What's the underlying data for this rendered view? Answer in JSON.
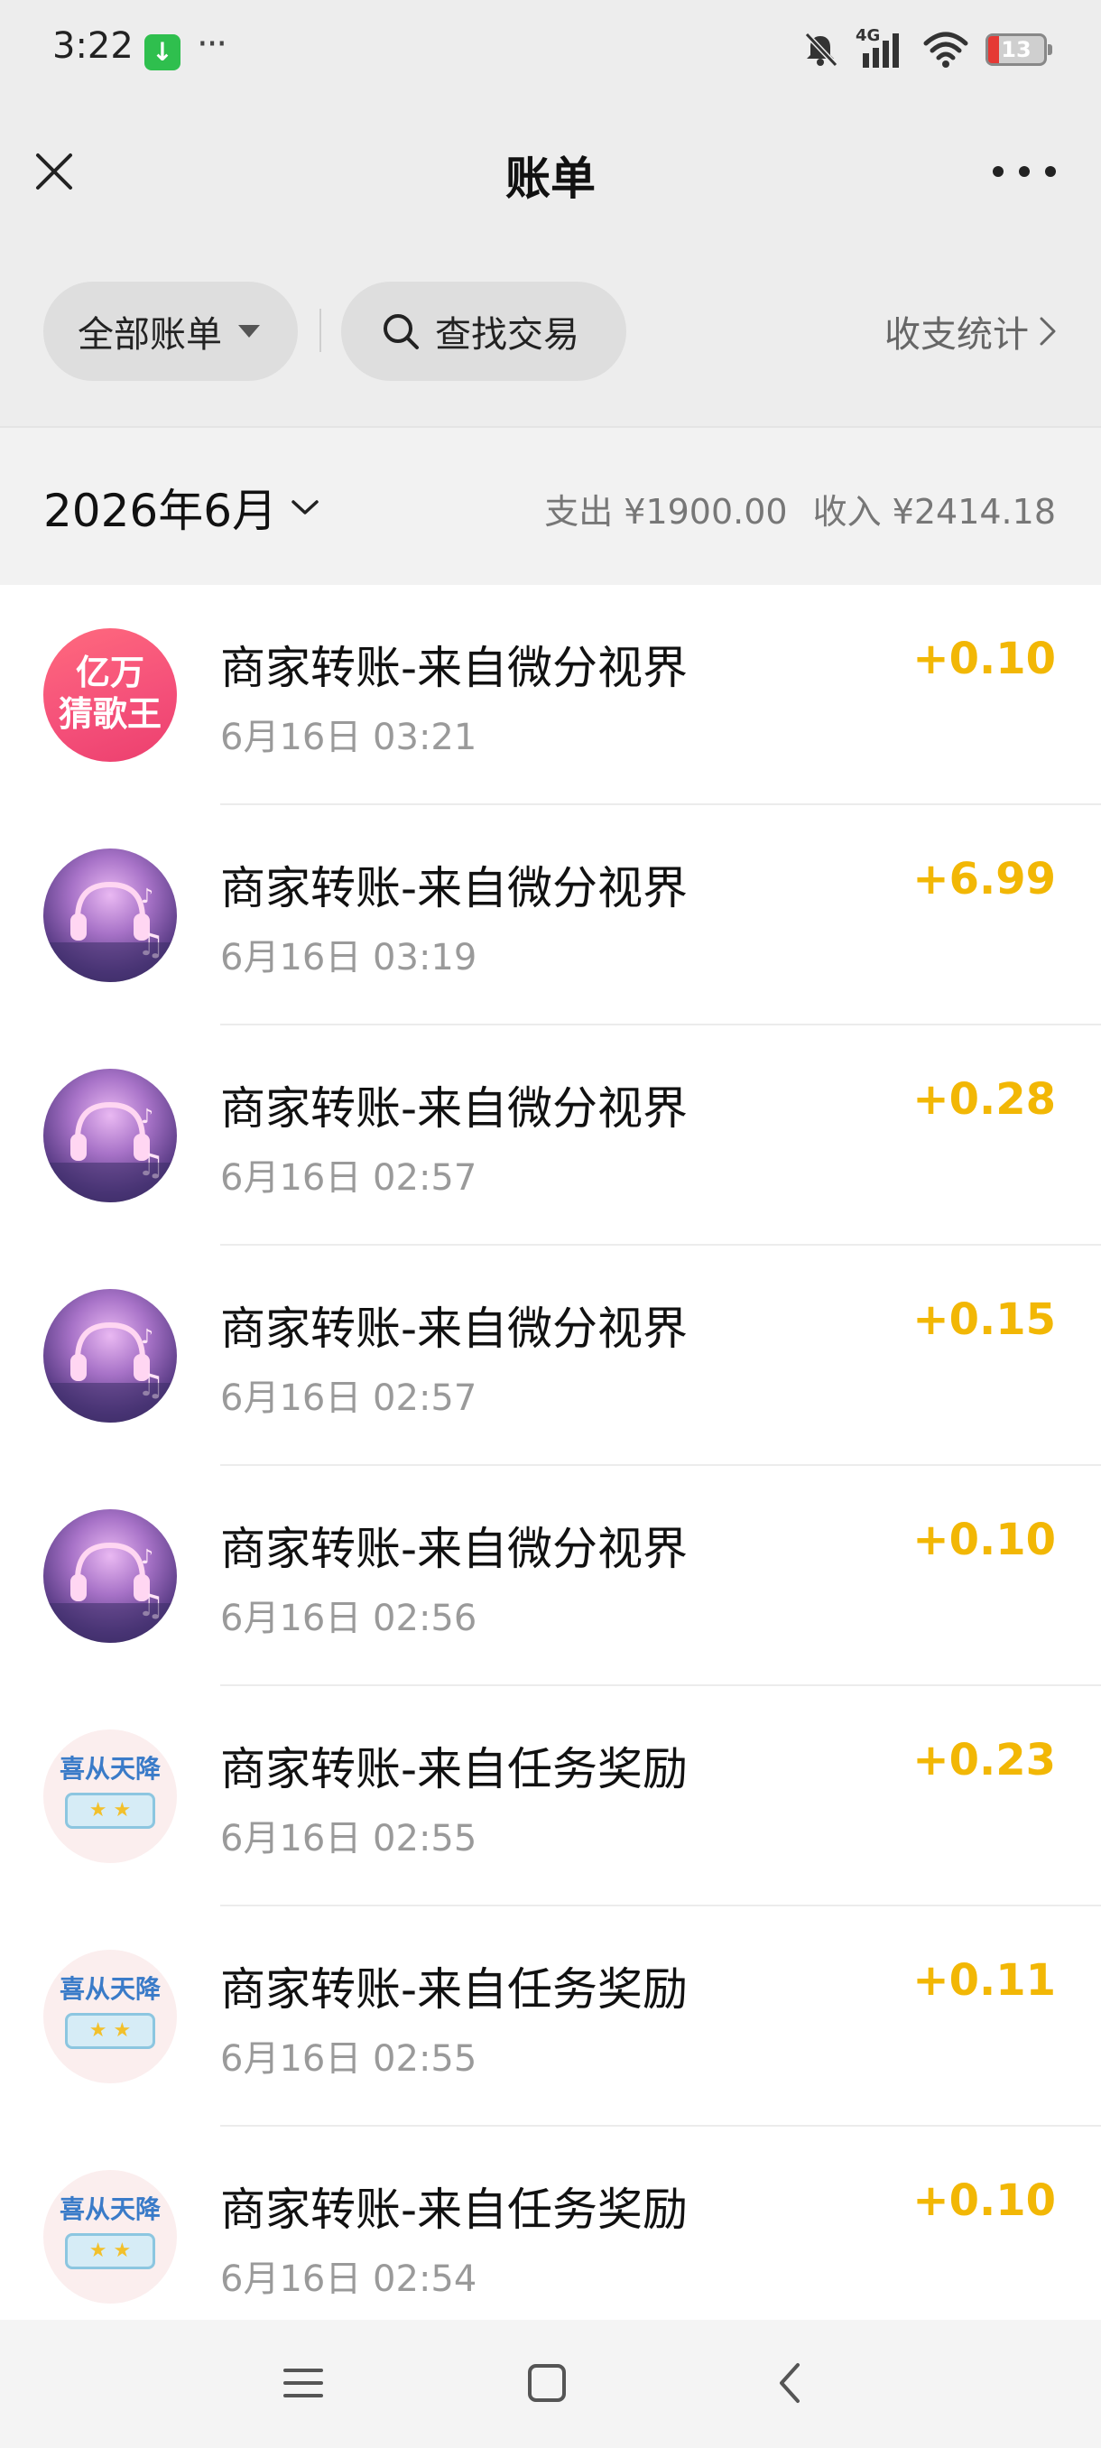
{
  "status_bar": {
    "time": "3:22",
    "more": "···",
    "network": "4G",
    "battery": "13"
  },
  "header": {
    "title": "账单"
  },
  "filters": {
    "all_bills": "全部账单",
    "search": "查找交易",
    "stats": "收支统计"
  },
  "month": {
    "label": "2026年6月",
    "expense": "支出 ¥1900.00",
    "income": "收入 ¥2414.18"
  },
  "transactions": [
    {
      "title": "商家转账-来自微分视界",
      "time": "6月16日 03:21",
      "amount": "+0.10",
      "avatar": "game-logo",
      "avatar_line1": "亿万",
      "avatar_line2": "猜歌王"
    },
    {
      "title": "商家转账-来自微分视界",
      "time": "6月16日 03:19",
      "amount": "+6.99",
      "avatar": "music-headphones"
    },
    {
      "title": "商家转账-来自微分视界",
      "time": "6月16日 02:57",
      "amount": "+0.28",
      "avatar": "music-headphones"
    },
    {
      "title": "商家转账-来自微分视界",
      "time": "6月16日 02:57",
      "amount": "+0.15",
      "avatar": "music-headphones"
    },
    {
      "title": "商家转账-来自微分视界",
      "time": "6月16日 02:56",
      "amount": "+0.10",
      "avatar": "music-headphones"
    },
    {
      "title": "商家转账-来自任务奖励",
      "time": "6月16日 02:55",
      "amount": "+0.23",
      "avatar": "reward-logo",
      "avatar_text": "喜从天降"
    },
    {
      "title": "商家转账-来自任务奖励",
      "time": "6月16日 02:55",
      "amount": "+0.11",
      "avatar": "reward-logo",
      "avatar_text": "喜从天降"
    },
    {
      "title": "商家转账-来自任务奖励",
      "time": "6月16日 02:54",
      "amount": "+0.10",
      "avatar": "reward-logo",
      "avatar_text": "喜从天降"
    }
  ],
  "colors": {
    "amount": "#f2b705",
    "top_background": "#ededed",
    "month_background": "#f2f2f2"
  }
}
